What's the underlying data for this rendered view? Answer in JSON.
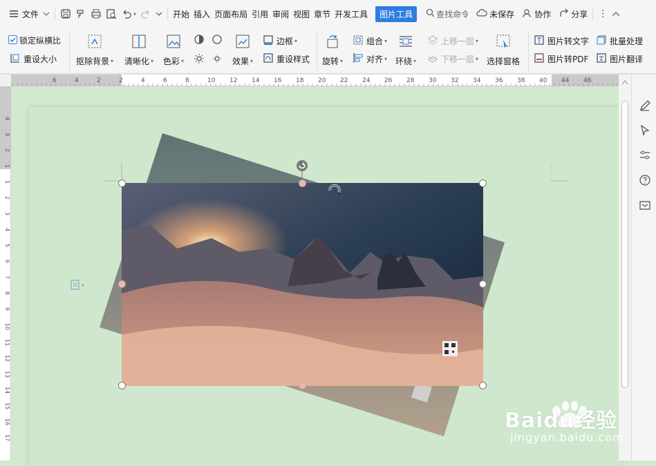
{
  "menubar": {
    "file": "文件",
    "tabs": [
      "开始",
      "插入",
      "页面布局",
      "引用",
      "审阅",
      "视图",
      "章节",
      "开发工具"
    ],
    "active_tab": "图片工具",
    "search": "查找命令",
    "unsaved": "未保存",
    "collab": "协作",
    "share": "分享"
  },
  "ribbon": {
    "lock_ratio": "锁定纵横比",
    "reset_size": "重设大小",
    "remove_bg": "抠除背景",
    "clarify": "清晰化",
    "color": "色彩",
    "effect": "效果",
    "border": "边框",
    "reset_style": "重设样式",
    "rotate": "旋转",
    "group": "组合",
    "align": "对齐",
    "wrap": "环绕",
    "bring_forward": "上移一层",
    "send_backward": "下移一层",
    "selection_pane": "选择窗格",
    "img_to_text": "图片转文字",
    "img_to_pdf": "图片转PDF",
    "batch": "批量处理",
    "translate": "图片翻译"
  },
  "ruler": {
    "h_ticks": [
      "6",
      "4",
      "2",
      "2",
      "4",
      "6",
      "8",
      "10",
      "12",
      "14",
      "16",
      "18",
      "20",
      "22",
      "24",
      "26",
      "28",
      "30",
      "32",
      "34",
      "36",
      "38",
      "40",
      "44",
      "46"
    ],
    "v_ticks": [
      "4",
      "3",
      "2",
      "1",
      "1",
      "2",
      "3",
      "4",
      "5",
      "6",
      "7",
      "8",
      "9",
      "10",
      "11",
      "12",
      "13",
      "14",
      "15",
      "16",
      "17"
    ]
  },
  "watermark": {
    "brand": "Baidu经验",
    "url": "jingyan.baidu.com"
  },
  "colors": {
    "accent": "#2f7de1",
    "page_bg": "#cfe8cd"
  }
}
